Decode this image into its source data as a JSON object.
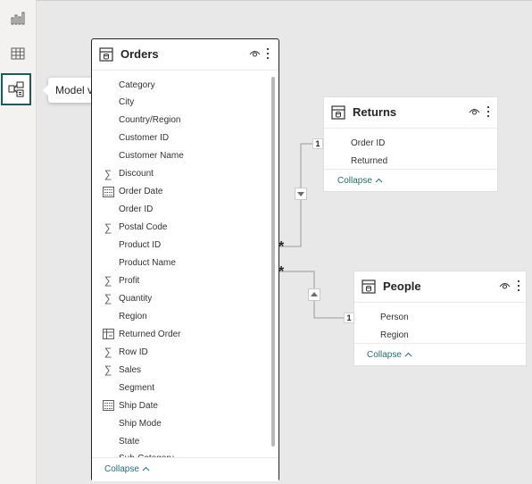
{
  "rail": {
    "items": [
      {
        "name": "report-view",
        "icon": "bar-chart-icon"
      },
      {
        "name": "table-view",
        "icon": "table-grid-icon"
      },
      {
        "name": "model-view",
        "icon": "model-diagram-icon",
        "active": true
      }
    ],
    "tooltip": "Model view",
    "active_color": "#1c5b5b"
  },
  "orders": {
    "title": "Orders",
    "fields": [
      {
        "label": "Category",
        "icon": "none"
      },
      {
        "label": "City",
        "icon": "none"
      },
      {
        "label": "Country/Region",
        "icon": "none"
      },
      {
        "label": "Customer ID",
        "icon": "none"
      },
      {
        "label": "Customer Name",
        "icon": "none"
      },
      {
        "label": "Discount",
        "icon": "sigma-icon"
      },
      {
        "label": "Order Date",
        "icon": "calendar-icon"
      },
      {
        "label": "Order ID",
        "icon": "none"
      },
      {
        "label": "Postal Code",
        "icon": "sigma-icon"
      },
      {
        "label": "Product ID",
        "icon": "none"
      },
      {
        "label": "Product Name",
        "icon": "none"
      },
      {
        "label": "Profit",
        "icon": "sigma-icon"
      },
      {
        "label": "Quantity",
        "icon": "sigma-icon"
      },
      {
        "label": "Region",
        "icon": "none"
      },
      {
        "label": "Returned Order",
        "icon": "calculated-column-icon"
      },
      {
        "label": "Row ID",
        "icon": "sigma-icon"
      },
      {
        "label": "Sales",
        "icon": "sigma-icon"
      },
      {
        "label": "Segment",
        "icon": "none"
      },
      {
        "label": "Ship Date",
        "icon": "calendar-icon"
      },
      {
        "label": "Ship Mode",
        "icon": "none"
      },
      {
        "label": "State",
        "icon": "none"
      },
      {
        "label": "Sub-Category",
        "icon": "none"
      }
    ],
    "collapse": "Collapse"
  },
  "returns": {
    "title": "Returns",
    "fields": [
      {
        "label": "Order ID",
        "icon": "none"
      },
      {
        "label": "Returned",
        "icon": "none"
      }
    ],
    "collapse": "Collapse"
  },
  "people": {
    "title": "People",
    "fields": [
      {
        "label": "Person",
        "icon": "none"
      },
      {
        "label": "Region",
        "icon": "none"
      }
    ],
    "collapse": "Collapse"
  },
  "relationships": [
    {
      "from": "Orders",
      "to": "Returns",
      "from_cardinality": "*",
      "to_cardinality": "1",
      "filter_direction": "down"
    },
    {
      "from": "Orders",
      "to": "People",
      "from_cardinality": "*",
      "to_cardinality": "1",
      "filter_direction": "up"
    }
  ],
  "symbols": {
    "collapse_chevron": "^",
    "sigma": "∑"
  }
}
